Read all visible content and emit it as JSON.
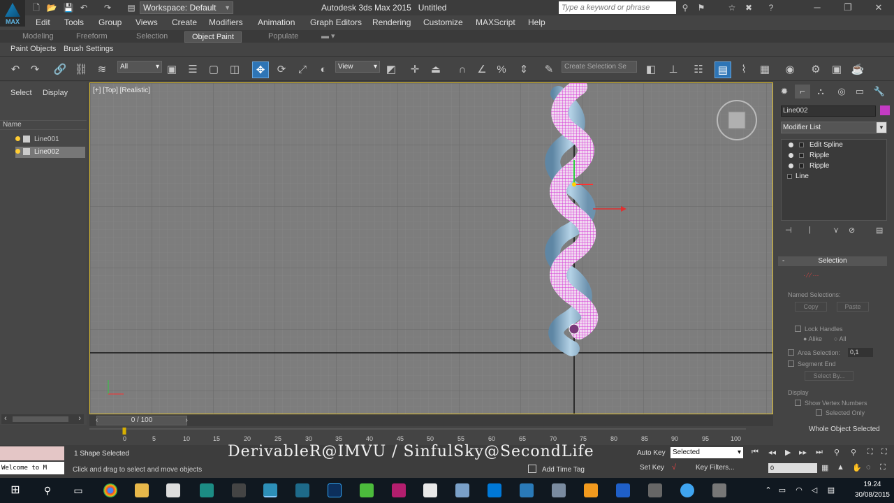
{
  "window": {
    "app_title": "Autodesk 3ds Max 2015",
    "doc_title": "Untitled",
    "workspace": "Workspace: Default",
    "search_placeholder": "Type a keyword or phrase",
    "logo_text": "MAX"
  },
  "menu": [
    "Edit",
    "Tools",
    "Group",
    "Views",
    "Create",
    "Modifiers",
    "Animation",
    "Graph Editors",
    "Rendering",
    "Customize",
    "MAXScript",
    "Help"
  ],
  "ribbon_tabs": [
    "Modeling",
    "Freeform",
    "Selection",
    "Object Paint",
    "Populate"
  ],
  "ribbon_active": "Object Paint",
  "sub_ribbon": [
    "Paint Objects",
    "Brush Settings"
  ],
  "toolbar": {
    "selection_filter": "All",
    "ref_coord": "View",
    "named_selection_placeholder": "Create Selection Se"
  },
  "scene_explorer": {
    "tabs": [
      "Select",
      "Display"
    ],
    "column": "Name",
    "items": [
      {
        "name": "Line001",
        "selected": false
      },
      {
        "name": "Line002",
        "selected": true
      }
    ]
  },
  "viewport": {
    "label": "[+] [Top] [Realistic]"
  },
  "command_panel": {
    "object_name": "Line002",
    "object_color": "#c43bc4",
    "modifier_list": "Modifier List",
    "stack": [
      "Edit Spline",
      "Ripple",
      "Ripple",
      "Line"
    ],
    "rollout": "Selection",
    "named_selections": "Named Selections:",
    "copy": "Copy",
    "paste": "Paste",
    "lock_handles": "Lock Handles",
    "alike": "Alike",
    "all": "All",
    "area_selection": "Area Selection:",
    "area_value": "0,1",
    "segment_end": "Segment End",
    "select_by": "Select By...",
    "display": "Display",
    "show_vertex_numbers": "Show Vertex Numbers",
    "selected_only": "Selected Only",
    "whole_object": "Whole Object Selected"
  },
  "timeline": {
    "slider": "0 / 100",
    "ticks": [
      "0",
      "5",
      "10",
      "15",
      "20",
      "25",
      "30",
      "35",
      "40",
      "45",
      "50",
      "55",
      "60",
      "65",
      "70",
      "75",
      "80",
      "85",
      "90",
      "95",
      "100"
    ]
  },
  "status": {
    "welcome": "Welcome to M",
    "selection_status": "1 Shape Selected",
    "prompt": "Click and drag to select and move objects",
    "watermark": "DerivableR@IMVU / SinfulSky@SecondLife",
    "auto_key": "Auto Key",
    "selected_mode": "Selected",
    "set_key": "Set Key",
    "key_filters": "Key Filters...",
    "add_time_tag": "Add Time Tag",
    "frame": "0"
  },
  "taskbar": {
    "time": "19.24",
    "date": "30/08/2015"
  },
  "colors": {
    "accent": "#2e75b6",
    "viewport_border": "#e0c030",
    "wireframe": "#d63ad6",
    "spline_body": "#8fb4d0"
  }
}
